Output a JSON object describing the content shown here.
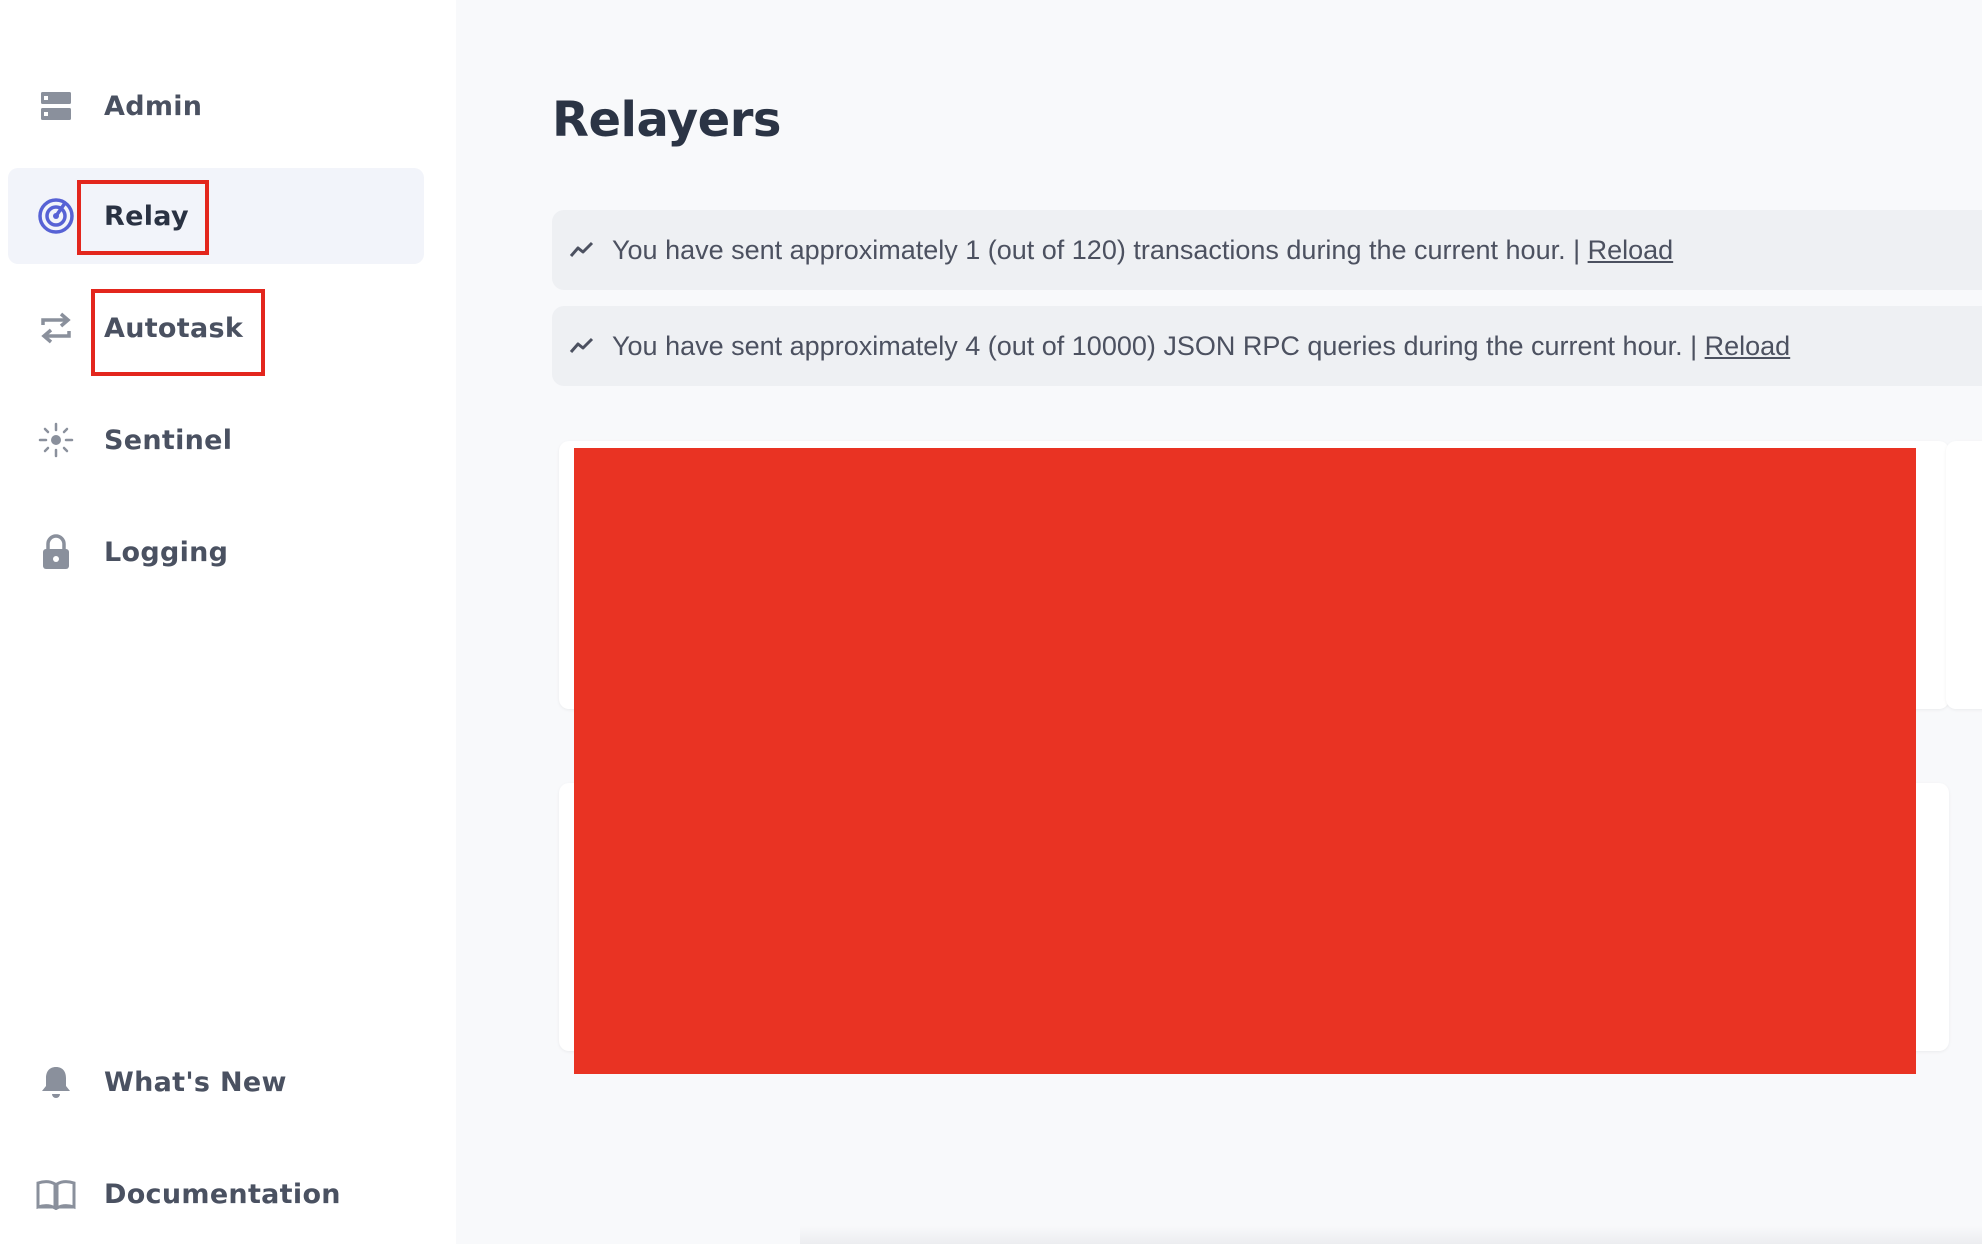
{
  "sidebar": {
    "items": [
      {
        "label": "Admin",
        "icon": "server-icon",
        "active": false
      },
      {
        "label": "Relay",
        "icon": "relay-target-icon",
        "active": true
      },
      {
        "label": "Autotask",
        "icon": "repeat-arrows-icon",
        "active": false
      },
      {
        "label": "Sentinel",
        "icon": "sentinel-icon",
        "active": false
      },
      {
        "label": "Logging",
        "icon": "lock-icon",
        "active": false
      }
    ],
    "bottom_items": [
      {
        "label": "What's New",
        "icon": "bell-icon"
      },
      {
        "label": "Documentation",
        "icon": "book-icon"
      }
    ]
  },
  "main": {
    "title": "Relayers",
    "banners": [
      {
        "text": "You have sent approximately 1 (out of 120) transactions during the current hour. | ",
        "link": "Reload",
        "icon": "trend-line-icon"
      },
      {
        "text": "You have sent approximately 4 (out of 10000) JSON RPC queries during the current hour. | ",
        "link": "Reload",
        "icon": "trend-line-icon"
      }
    ]
  },
  "colors": {
    "accent": "#5762d5",
    "highlight": "#e3261d",
    "redaction": "#e93323",
    "text_dark": "#2b3445",
    "text_muted": "#4a5161"
  }
}
